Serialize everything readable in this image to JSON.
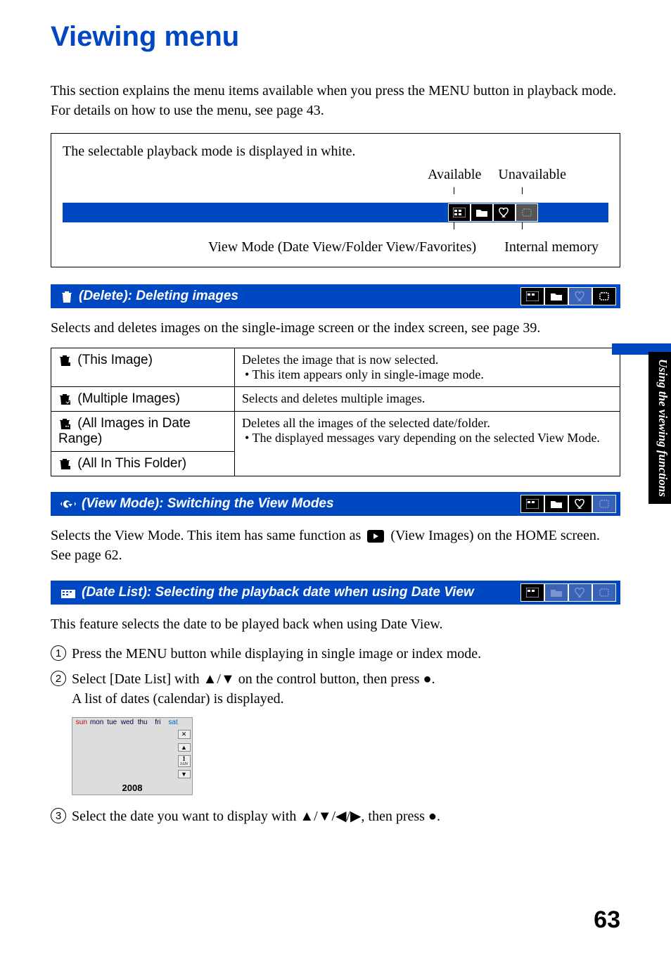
{
  "title": "Viewing menu",
  "intro": "This section explains the menu items available when you press the MENU button in playback mode. For details on how to use the menu, see page 43.",
  "mode_box": {
    "top_text": "The selectable playback mode is displayed in white.",
    "available_label": "Available",
    "unavailable_label": "Unavailable",
    "bottom_left": "View Mode (Date View/Folder View/Favorites)",
    "bottom_right": "Internal memory"
  },
  "delete": {
    "heading": " (Delete): Deleting images",
    "icon_name": "trash-icon",
    "mode_icons": [
      "date-view-icon",
      "folder-view-icon",
      "favorites-icon",
      "internal-memory-icon"
    ],
    "mode_icons_state": [
      "on",
      "on",
      "off",
      "on"
    ],
    "body": "Selects and deletes images on the single-image screen or the index screen, see page 39.",
    "rows": [
      {
        "label": "(This Image)",
        "icon": "trash-single-icon",
        "desc_main": "Deletes the image that is now selected.",
        "desc_bullet": "This item appears only in single-image mode."
      },
      {
        "label": "(Multiple Images)",
        "icon": "trash-multi-icon",
        "desc_main": "Selects and deletes multiple images.",
        "desc_bullet": ""
      },
      {
        "label": "(All Images in Date Range)",
        "icon": "trash-date-icon",
        "desc_main": "Deletes all the images of the selected date/folder.",
        "desc_bullet": "The displayed messages vary depending on the selected View Mode."
      },
      {
        "label": "(All In This Folder)",
        "icon": "trash-folder-icon",
        "desc_main": "",
        "desc_bullet": ""
      }
    ]
  },
  "view_mode": {
    "heading": " (View Mode): Switching the View Modes",
    "icon_name": "view-mode-icon",
    "mode_icons_state": [
      "on",
      "on",
      "on",
      "off"
    ],
    "body_1": "Selects the View Mode. This item has same function as ",
    "inline_label": "(View Images)",
    "body_2": " on the HOME screen.",
    "see": "See page 62."
  },
  "date_list": {
    "heading": " (Date List): Selecting the playback date when using Date View",
    "icon_name": "date-list-icon",
    "mode_icons_state": [
      "on",
      "off",
      "off",
      "off"
    ],
    "body": "This feature selects the date to be played back when using Date View.",
    "steps": [
      "Press the MENU button while displaying in single image or index mode.",
      "Select [Date List] with ▲/▼ on the control button, then press ●.\nA list of dates (calendar) is displayed.",
      "Select the date you want to display with ▲/▼/◀/▶, then press ●."
    ],
    "calendar": {
      "days": [
        "sun",
        "mon",
        "tue",
        "wed",
        "thu",
        "fri",
        "sat"
      ],
      "year": "2008",
      "month_label": "1",
      "month_sub": "JAN"
    }
  },
  "side_tab": "Using the viewing functions",
  "page_number": "63"
}
